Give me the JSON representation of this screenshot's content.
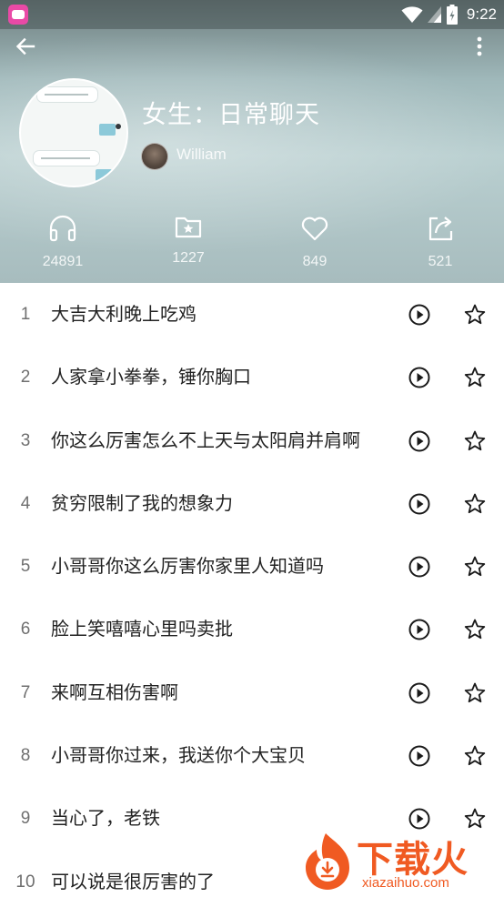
{
  "status_bar": {
    "time": "9:22"
  },
  "playlist": {
    "title": "女生：日常聊天",
    "author": "William"
  },
  "stats": {
    "listens": "24891",
    "collects": "1227",
    "likes": "849",
    "shares": "521"
  },
  "tracks": [
    {
      "index": "1",
      "title": "大吉大利晚上吃鸡"
    },
    {
      "index": "2",
      "title": "人家拿小拳拳，锤你胸口"
    },
    {
      "index": "3",
      "title": "你这么厉害怎么不上天与太阳肩并肩啊"
    },
    {
      "index": "4",
      "title": "贫穷限制了我的想象力"
    },
    {
      "index": "5",
      "title": "小哥哥你这么厉害你家里人知道吗"
    },
    {
      "index": "6",
      "title": "脸上笑嘻嘻心里吗卖批"
    },
    {
      "index": "7",
      "title": "来啊互相伤害啊"
    },
    {
      "index": "8",
      "title": "小哥哥你过来，我送你个大宝贝"
    },
    {
      "index": "9",
      "title": "当心了，老铁"
    },
    {
      "index": "10",
      "title": "可以说是很厉害的了"
    }
  ],
  "watermark": {
    "brand": "下载火",
    "domain": "xiazaihuo.com"
  },
  "colors": {
    "accent_watermark": "#f05a22",
    "list_text": "#222222",
    "index_text": "#6f6f6f"
  },
  "icons": {
    "back": "arrow-left-icon",
    "more": "more-vertical-icon",
    "listens": "headphones-icon",
    "collects": "folder-star-icon",
    "likes": "heart-icon",
    "shares": "share-icon",
    "play": "play-circle-icon",
    "favorite": "star-outline-icon"
  }
}
